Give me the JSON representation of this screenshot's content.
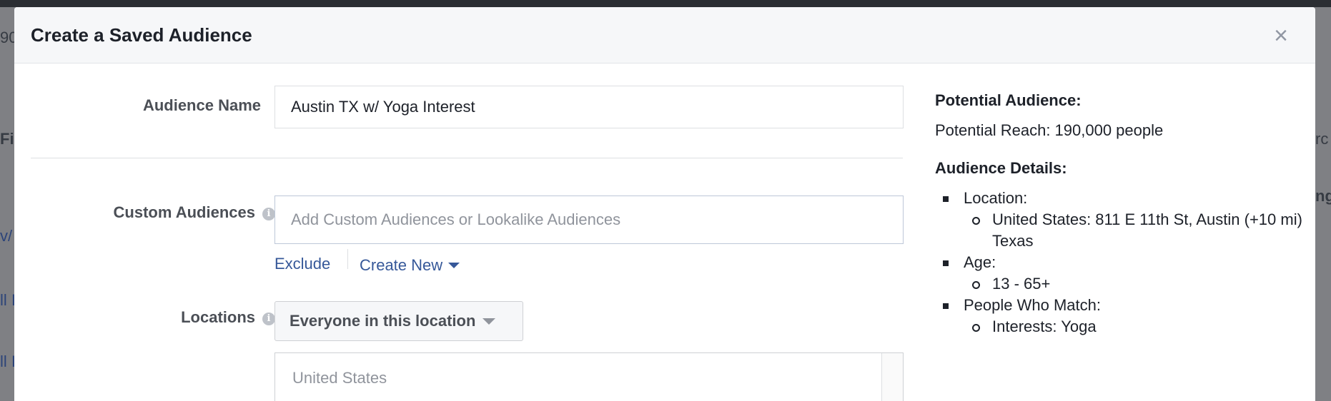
{
  "modal": {
    "title": "Create a Saved Audience",
    "close_glyph": "×"
  },
  "form": {
    "audience_name": {
      "label": "Audience Name",
      "value": "Austin TX w/ Yoga Interest"
    },
    "custom_audiences": {
      "label": "Custom Audiences",
      "placeholder": "Add Custom Audiences or Lookalike Audiences",
      "exclude_link": "Exclude",
      "create_new_link": "Create New"
    },
    "locations": {
      "label": "Locations",
      "dropdown_value": "Everyone in this location",
      "country": "United States"
    }
  },
  "summary": {
    "potential_heading": "Potential Audience:",
    "potential_reach": "Potential Reach: 190,000 people",
    "details_heading": "Audience Details:",
    "details": [
      {
        "label": "Location:",
        "items": [
          "United States: 811 E 11th St, Austin (+10 mi) Texas"
        ]
      },
      {
        "label": "Age:",
        "items": [
          "13 - 65+"
        ]
      },
      {
        "label": "People Who Match:",
        "items": [
          "Interests: Yoga"
        ]
      }
    ]
  },
  "background_fragments": [
    "90",
    "Fil",
    "v/",
    "ll I",
    "ll I",
    "rc",
    "ng"
  ],
  "icons": {
    "info": "info-icon",
    "close": "close-icon",
    "caret": "chevron-down-icon"
  },
  "colors": {
    "link": "#365899",
    "header_bg": "#f6f7f9",
    "title": "#1d2129",
    "label": "#4b4f56"
  }
}
